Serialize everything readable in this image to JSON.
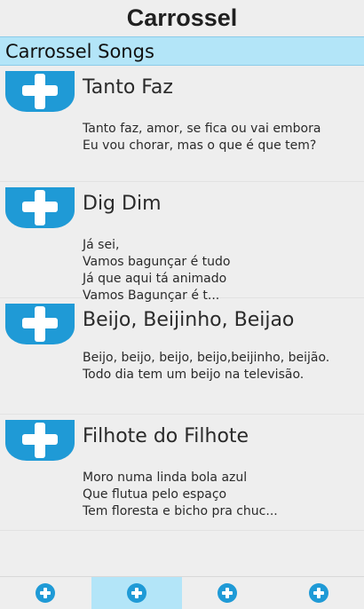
{
  "app": {
    "title": "Carrossel"
  },
  "section": {
    "title": "Carrossel Songs"
  },
  "songs": [
    {
      "title": "Tanto Faz",
      "lyrics": "Tanto faz, amor, se fica ou vai embora\nEu vou chorar, mas o que é que tem?"
    },
    {
      "title": "Dig Dim",
      "lyrics": "Já sei,\nVamos bagunçar é tudo\nJá que aqui tá animado\nVamos Bagunçar é t..."
    },
    {
      "title": "Beijo, Beijinho, Beijao",
      "lyrics": "Beijo, beijo, beijo, beijo,beijinho, beijão.\nTodo dia tem um beijo na televisão."
    },
    {
      "title": "Filhote do Filhote",
      "lyrics": "Moro numa linda bola azul\nQue flutua pelo espaço\nTem floresta e bicho pra chuc..."
    }
  ],
  "bottom_tabs": [
    {
      "icon": "add-circle-icon",
      "selected": false
    },
    {
      "icon": "add-circle-icon",
      "selected": true
    },
    {
      "icon": "add-circle-icon",
      "selected": false
    },
    {
      "icon": "add-circle-icon",
      "selected": false
    }
  ],
  "colors": {
    "accent": "#1f9ad6",
    "highlight": "#b3e5f8",
    "background": "#eeeeee"
  }
}
